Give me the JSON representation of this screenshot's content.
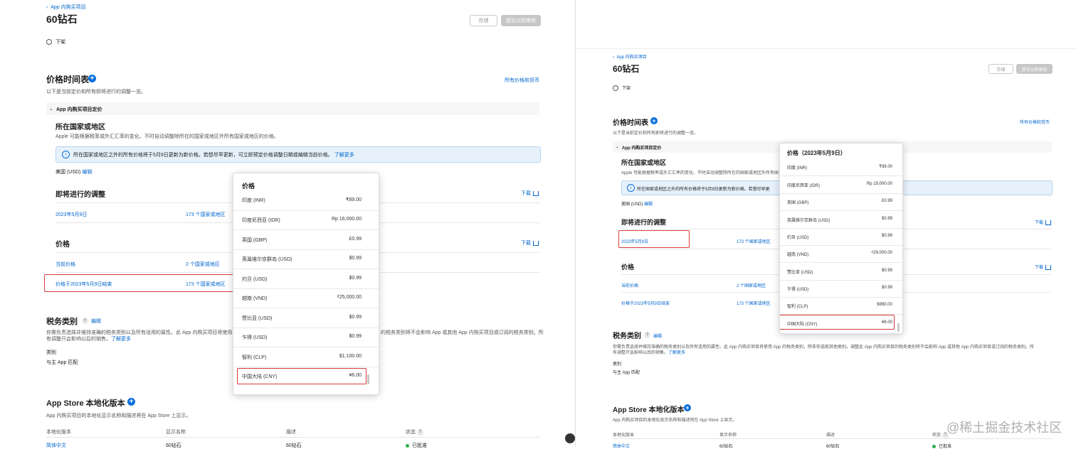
{
  "left": {
    "breadcrumb": "App 内购买项目",
    "title": "60钻石",
    "save_label": "存储",
    "submit_label": "提交以供审核",
    "status_radio": "下架",
    "price_schedule": {
      "heading": "价格时间表",
      "subtitle": "以下是当前定价和所有即将进行的调整一览。",
      "all_prices_link": "所有价格和货币",
      "section_label": "App 内购买项目定价",
      "region_heading": "所在国家或地区",
      "region_desc": "Apple 可能根据税率或外汇汇率的变化、不时自动调整除所在的国家或地区外所有国家或地区的价格。",
      "info_text": "所在国家或地区之外的所有价格将于5月9日更新为新价格。若想尽早更新，可立即预定价格调整日期或编辑当前价格。",
      "info_link": "了解更多",
      "base_region": "美国 (USD)",
      "edit_label": "编辑",
      "upcoming_heading": "即将进行的调整",
      "download_label": "下载",
      "upcoming_date": "2023年5月9日",
      "upcoming_regions": "173 个国家或地区",
      "prices_heading": "价格",
      "current_price": "当前价格",
      "current_regions": "2 个国家或地区",
      "ended_price": "价格于2023年5月9日结束",
      "ended_regions": "173 个国家或地区"
    },
    "tax": {
      "heading": "税务类别",
      "q": "?",
      "edit": "编辑",
      "desc_part1": "你需负责选择并维持准确的税务类别以及所有适用的属性。此 App 内购买项目将使用",
      "desc_part2": "的税务类别将不会影响 App 或其他 App 内购买项目或订阅的税务类别。所",
      "desc_line2": "有调整只会影响以后的销售。",
      "learn_more": "了解更多",
      "category_label": "类别",
      "category_value": "与主 App 匹配"
    },
    "localization": {
      "heading": "App Store 本地化版本",
      "desc": "App 内购买项目的本地化显示名称和描述将在 App Store 上显示。",
      "col_version": "本地化版本",
      "col_name": "显示名称",
      "col_desc": "描述",
      "col_status": "状态",
      "row_version": "简体中文",
      "row_name": "60钻石",
      "row_desc": "60钻石",
      "row_status": "已批准"
    },
    "popup": {
      "title": "价格",
      "rows": [
        {
          "country": "印度 (INR)",
          "price": "₹89.00"
        },
        {
          "country": "印度尼西亚 (IDR)",
          "price": "Rp 16,000.00"
        },
        {
          "country": "英国 (GBP)",
          "price": "£0.99"
        },
        {
          "country": "英属维尔京群岛 (USD)",
          "price": "$0.99"
        },
        {
          "country": "约旦 (USD)",
          "price": "$0.99"
        },
        {
          "country": "越南 (VND)",
          "price": "₫25,000.00"
        },
        {
          "country": "赞比亚 (USD)",
          "price": "$0.99"
        },
        {
          "country": "乍得 (USD)",
          "price": "$0.99"
        },
        {
          "country": "智利 (CLP)",
          "price": "$1,100.00"
        },
        {
          "country": "中国大陆 (CNY)",
          "price": "¥6.00"
        }
      ]
    }
  },
  "right": {
    "breadcrumb": "App 内购买项目",
    "title": "60钻石",
    "save_label": "存储",
    "submit_label": "提交以供审核",
    "status_radio": "下架",
    "price_schedule": {
      "heading": "价格时间表",
      "subtitle": "以下是当前定价和所有即将进行的调整一览。",
      "all_prices_link": "所有价格和货币",
      "section_label": "App 内购买项目定价",
      "region_heading": "所在国家或地区",
      "region_desc": "Apple 可能根据税率或外汇汇率的变化、不时自动调整除所在的国家或地区外所有国",
      "info_text": "所在国家或地区之外的所有价格将于5月9日更新为新价格。若想尽早更",
      "base_region": "美国 (USD)",
      "edit_label": "编辑",
      "upcoming_heading": "即将进行的调整",
      "download_label": "下载",
      "upcoming_date": "2023年5月9日",
      "upcoming_regions": "173 个国家或地区",
      "prices_heading": "价格",
      "current_price": "当前价格",
      "current_regions": "2 个国家或地区",
      "ended_price": "价格于2023年5月9日结束",
      "ended_regions": "173 个国家或地区"
    },
    "tax": {
      "heading": "税务类别",
      "q": "?",
      "edit": "编辑",
      "desc": "你需负责选择并维持准确的税务类别以及所有适用的属性。此 App 内购买项目将使用 App 的税务类别，除非你选取其他类别。调整此 App 内购买项目的税务类别将不会影响 App 或其他 App 内购买项目或订阅的税务类别。所",
      "desc_line2": "有调整只会影响以后的销售。",
      "learn_more": "了解更多",
      "category_label": "类别",
      "category_value": "与主 App 匹配"
    },
    "localization": {
      "heading": "App Store 本地化版本",
      "desc": "App 内购买项目的本地化显示名称和描述将在 App Store 上显示。",
      "col_version": "本地化版本",
      "col_name": "显示名称",
      "col_desc": "描述",
      "col_status": "状态",
      "row_version": "简体中文",
      "row_name": "60钻石",
      "row_desc": "60钻石",
      "row_status": "已批准"
    },
    "popup": {
      "title": "价格（2023年5月9日）",
      "rows": [
        {
          "country": "印度 (INR)",
          "price": "₹99.00"
        },
        {
          "country": "印度尼西亚 (IDR)",
          "price": "Rp 19,000.00"
        },
        {
          "country": "英国 (GBP)",
          "price": "£0.99"
        },
        {
          "country": "英属维尔京群岛 (USD)",
          "price": "$0.99"
        },
        {
          "country": "约旦 (USD)",
          "price": "$0.99"
        },
        {
          "country": "越南 (VND)",
          "price": "₫29,000.00"
        },
        {
          "country": "赞比亚 (USD)",
          "price": "$0.99"
        },
        {
          "country": "乍得 (USD)",
          "price": "$0.99"
        },
        {
          "country": "智利 (CLP)",
          "price": "$990.00"
        },
        {
          "country": "中国大陆 (CNY)",
          "price": "¥8.00"
        }
      ]
    }
  },
  "watermark": "@稀土掘金技术社区"
}
